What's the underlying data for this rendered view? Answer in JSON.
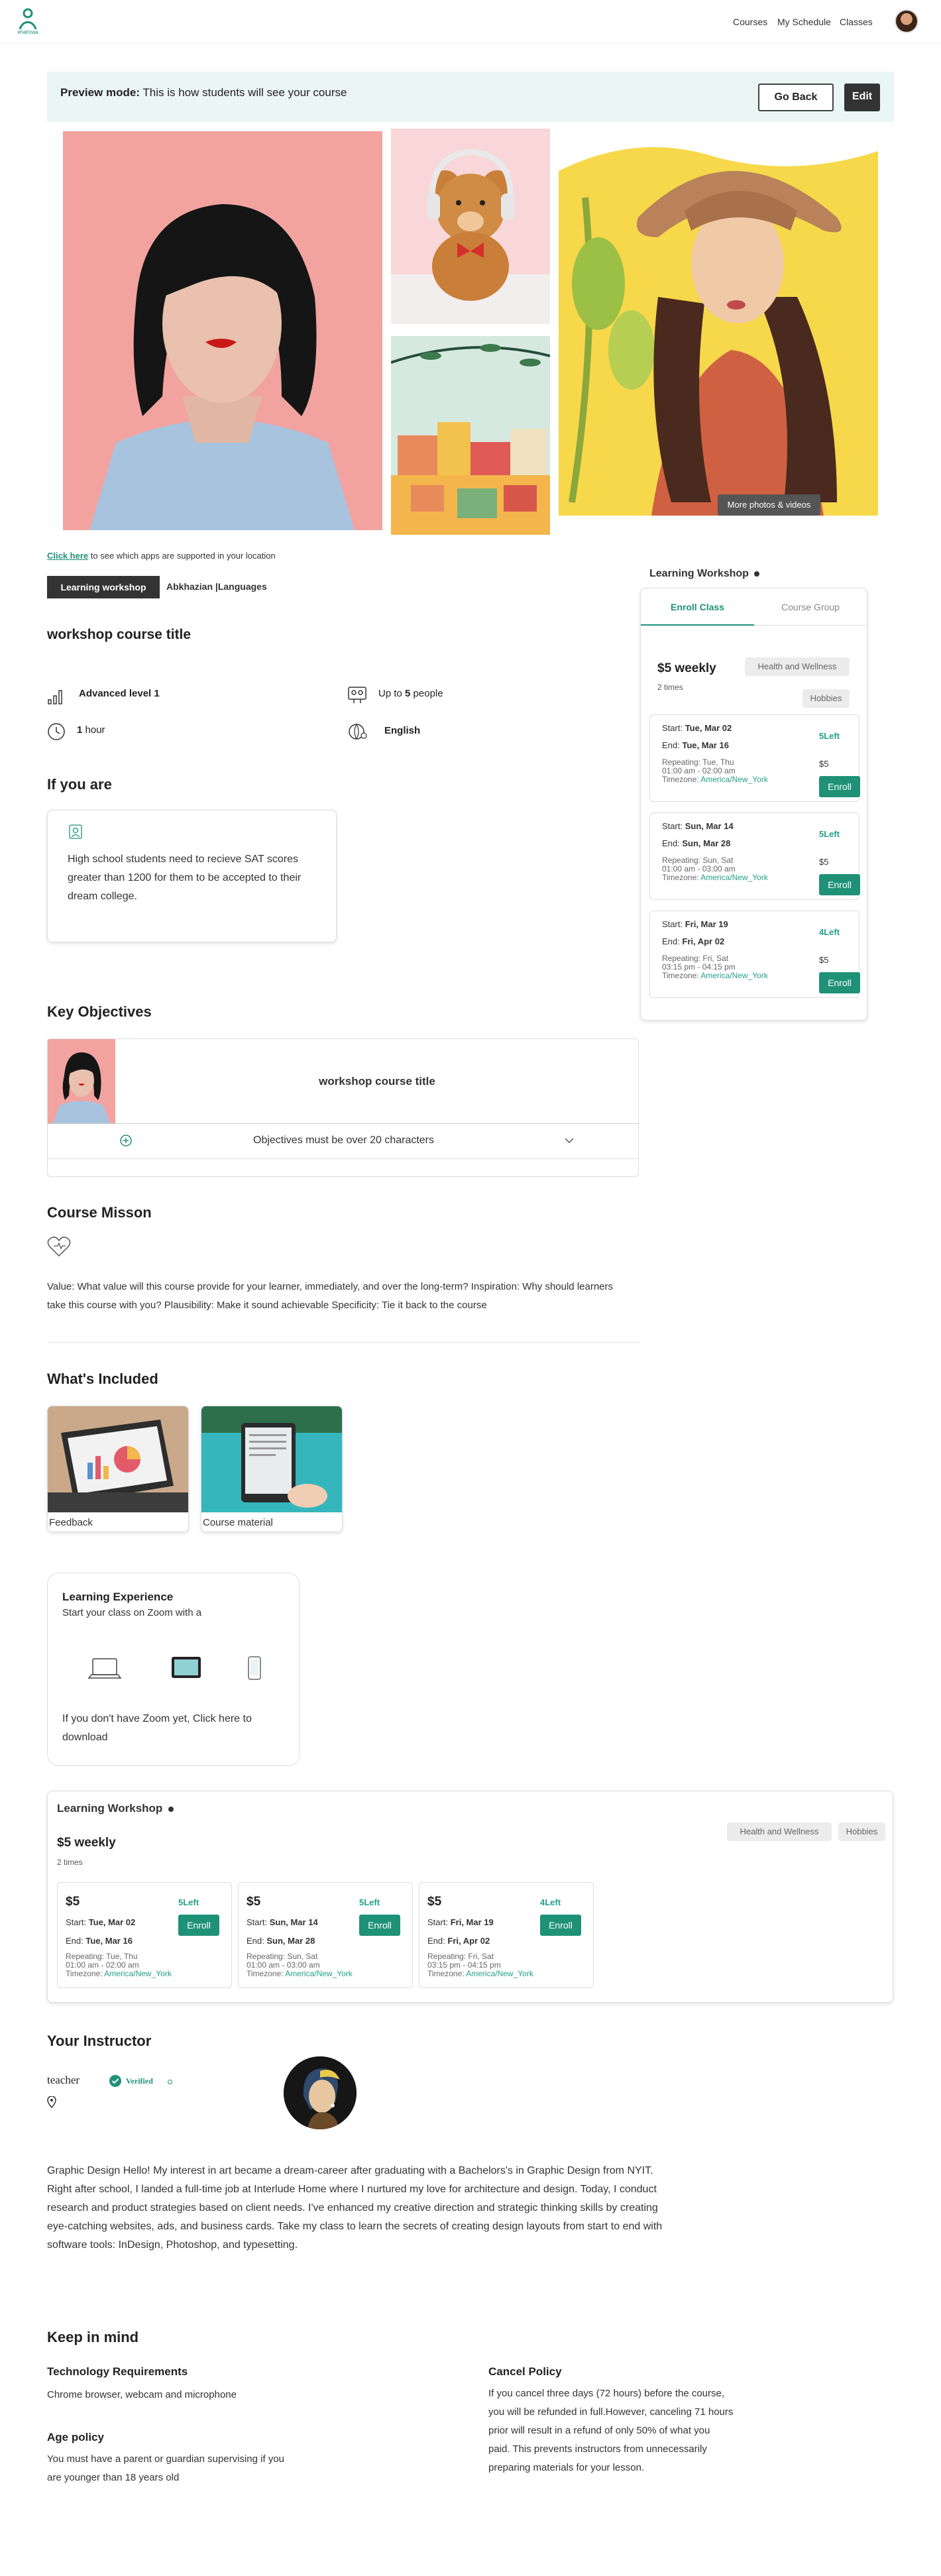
{
  "brand": {
    "name": "ehahnaa",
    "color": "#1f9177"
  },
  "nav": {
    "courses": "Courses",
    "my_schedule": "My Schedule",
    "classes": "Classes"
  },
  "preview": {
    "label": "Preview mode:",
    "text": "This is how students will see your course",
    "go_back": "Go Back",
    "edit": "Edit"
  },
  "gallery": {
    "more_photos": "More photos & videos"
  },
  "location": {
    "link": "Click here",
    "text": "to see which apps are supported in your location"
  },
  "tags": {
    "workshop": "Learning workshop",
    "languages": "Abkhazian |Languages"
  },
  "course": {
    "title": "workshop course title",
    "level": "Advanced level 1",
    "capacity_prefix": "Up to",
    "capacity_num": "5",
    "capacity_suffix": "people",
    "duration_num": "1",
    "duration_unit": "hour",
    "language": "English"
  },
  "if_you_are": {
    "title": "If you are",
    "text": "High school students need to recieve SAT scores greater than 1200 for them to be accepted to their dream college."
  },
  "objectives": {
    "title": "Key Objectives",
    "course_title": "workshop course title",
    "item": "Objectives must be over 20 characters"
  },
  "mission": {
    "title": "Course Misson",
    "text": "Value: What value will this course provide for your learner, immediately, and over the long-term? Inspiration: Why should learners take this course with you? Plausibility: Make it sound achievable Specificity: Tie it back to the course"
  },
  "included": {
    "title": "What's Included",
    "items": [
      "Feedback",
      "Course material"
    ]
  },
  "experience": {
    "title": "Learning Experience",
    "subtitle": "Start your class on Zoom with a",
    "note": "If you don't have Zoom yet, Click here to download"
  },
  "enroll_panel": {
    "title": "Learning Workshop",
    "tab_enroll": "Enroll Class",
    "tab_group": "Course Group",
    "price": "$5 weekly",
    "times": "2 times",
    "categories": [
      "Health and Wellness",
      "Hobbies"
    ],
    "enroll_label": "Enroll",
    "sessions": [
      {
        "start_label": "Start:",
        "start": "Tue, Mar 02",
        "end_label": "End:",
        "end": "Tue, Mar 16",
        "left": "5Left",
        "repeat": "Repeating: Tue, Thu",
        "time": "01:00 am - 02:00 am",
        "tz_label": "Timezone:",
        "tz": "America/New_York",
        "price": "$5"
      },
      {
        "start_label": "Start:",
        "start": "Sun, Mar 14",
        "end_label": "End:",
        "end": "Sun, Mar 28",
        "left": "5Left",
        "repeat": "Repeating: Sun, Sat",
        "time": "01:00 am - 03:00 am",
        "tz_label": "Timezone:",
        "tz": "America/New_York",
        "price": "$5"
      },
      {
        "start_label": "Start:",
        "start": "Fri, Mar 19",
        "end_label": "End:",
        "end": "Fri, Apr 02",
        "left": "4Left",
        "repeat": "Repeating: Fri, Sat",
        "time": "03:15 pm - 04:15 pm",
        "tz_label": "Timezone:",
        "tz": "America/New_York",
        "price": "$5"
      }
    ]
  },
  "instructor": {
    "title": "Your Instructor",
    "name": "teacher",
    "verified": "Verified",
    "bio": "Graphic Design Hello! My interest in art became a dream-career after graduating with a Bachelors's in Graphic Design from NYIT. Right after school, I landed a full-time job at Interlude Home where I nurtured my love for architecture and design. Today, I conduct research and product strategies based on client needs. I've enhanced my creative direction and strategic thinking skills by creating eye-catching websites, ads, and business cards. Take my class to learn the secrets of creating design layouts from start to end with software tools: InDesign, Photoshop, and typesetting."
  },
  "keep_in_mind": {
    "title": "Keep in mind",
    "tech_title": "Technology Requirements",
    "tech_text": "Chrome browser, webcam and microphone",
    "age_title": "Age policy",
    "age_text": "You must have a parent or guardian supervising if you are younger than 18 years old",
    "cancel_title": "Cancel Policy",
    "cancel_text": "If you cancel three days (72 hours) before the course, you will be refunded in full.However, canceling 71 hours prior will result in a refund of only 50% of what you paid. This prevents instructors from unnecessarily preparing materials for your lesson."
  }
}
